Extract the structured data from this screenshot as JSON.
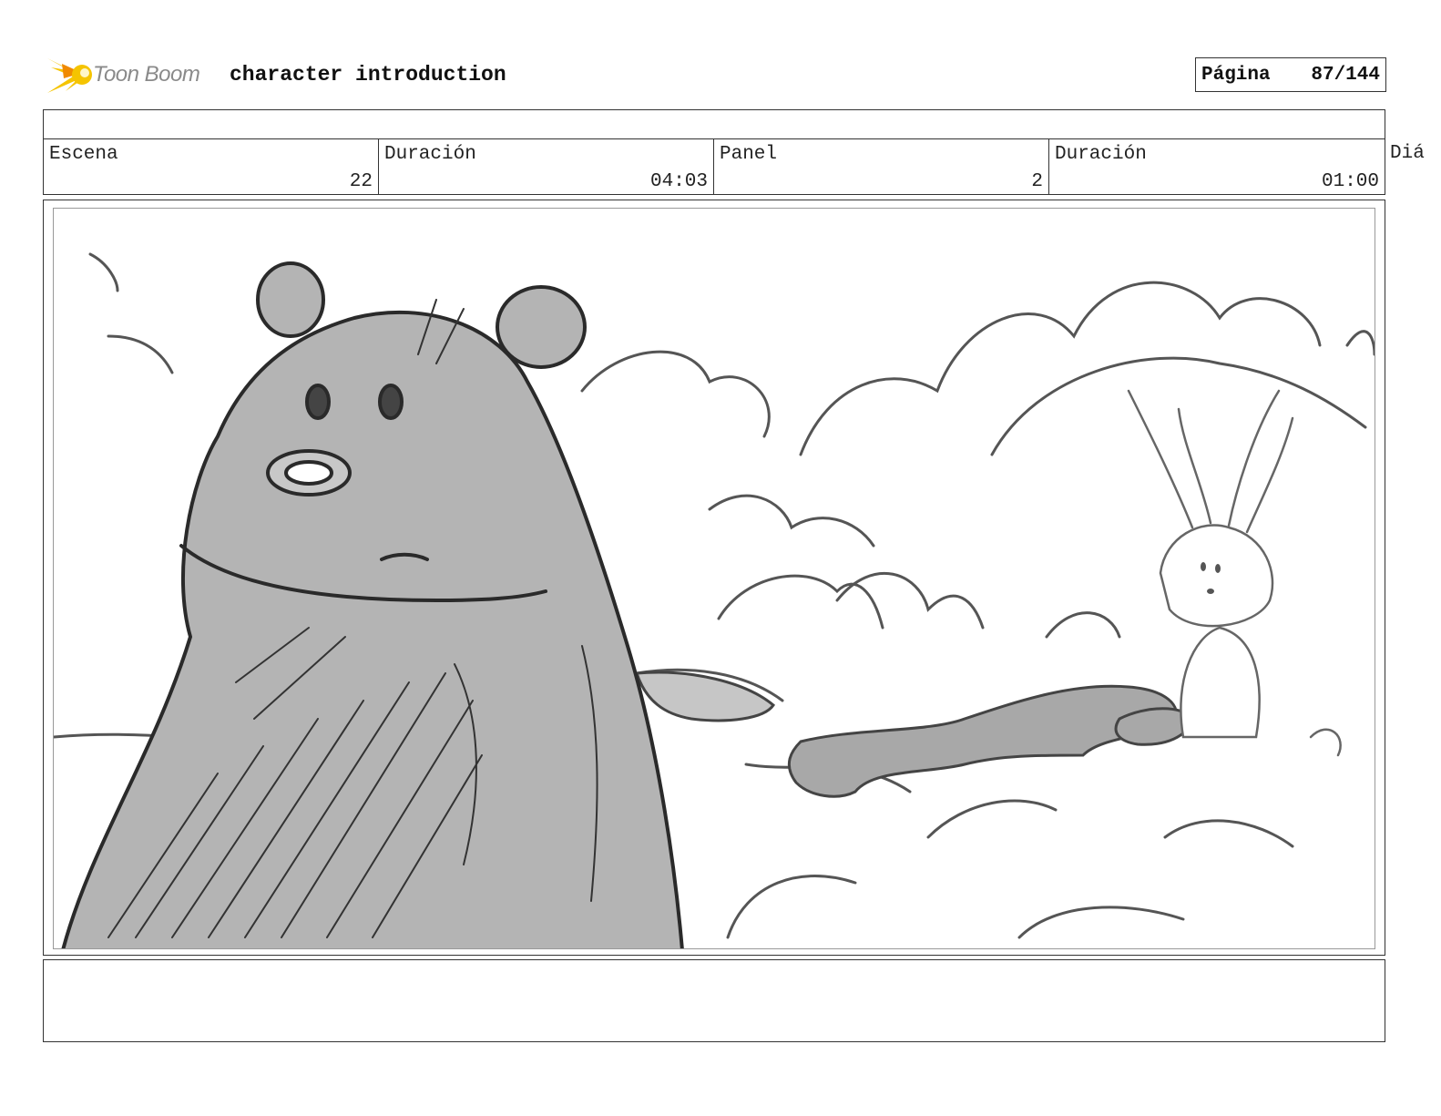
{
  "header": {
    "logo_text": "Toon Boom",
    "project_title": "character introduction",
    "page_label": "Página",
    "page_number": "87/144"
  },
  "info": {
    "scene": {
      "label": "Escena",
      "value": "22"
    },
    "scene_duration": {
      "label": "Duración",
      "value": "04:03"
    },
    "panel": {
      "label": "Panel",
      "value": "2"
    },
    "panel_duration": {
      "label": "Duración",
      "value": "01:00"
    },
    "extra_label": "Diá"
  },
  "panel_image": {
    "icon": "storyboard-sketch-bear-and-rabbit"
  },
  "colors": {
    "logo_yellow": "#f5c400",
    "logo_orange": "#f08a00",
    "sketch_fill": "#b4b4b4",
    "sketch_line": "#2a2a2a"
  }
}
